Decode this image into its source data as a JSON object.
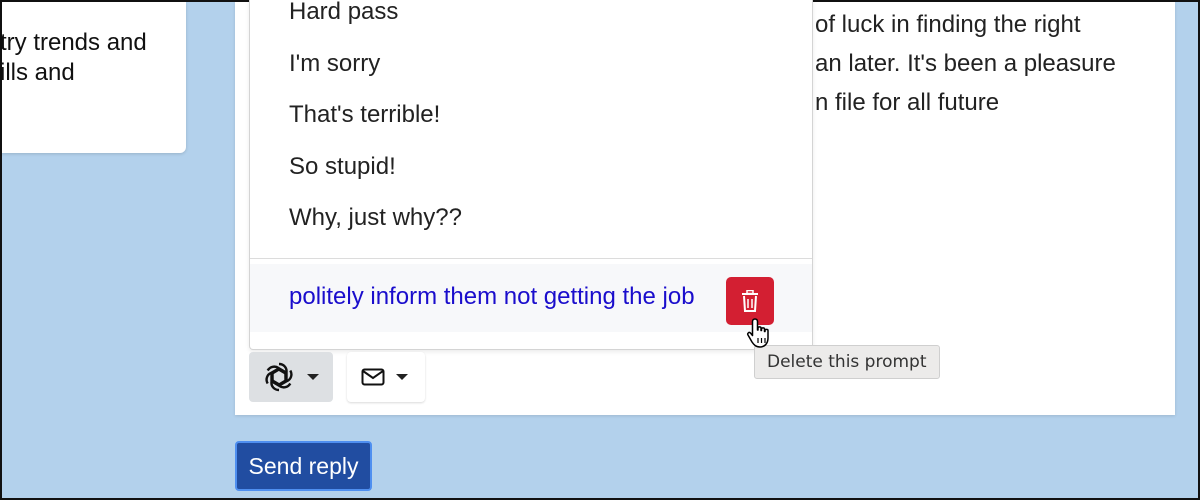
{
  "left_card": {
    "lines": [
      "try trends and",
      "ills and"
    ]
  },
  "email_body": {
    "lines": [
      "of luck in finding the right",
      "an later. It's been a pleasure",
      "n file for all future"
    ]
  },
  "prompt_dropdown": {
    "items": [
      "Hard pass",
      "I'm sorry",
      "That's terrible!",
      "So stupid!",
      "Why, just why??"
    ],
    "custom_prompt": "politely inform them not getting the job",
    "delete_icon": "trash-icon"
  },
  "toolbar": {
    "ai_icon": "openai-logo-icon",
    "mail_icon": "envelope-icon"
  },
  "tooltip": {
    "text": "Delete this prompt"
  },
  "send_button": {
    "label": "Send reply"
  },
  "colors": {
    "background": "#b3d1ec",
    "delete_red": "#d31f32",
    "link_blue": "#1a0dcc",
    "send_blue": "#214da1"
  }
}
